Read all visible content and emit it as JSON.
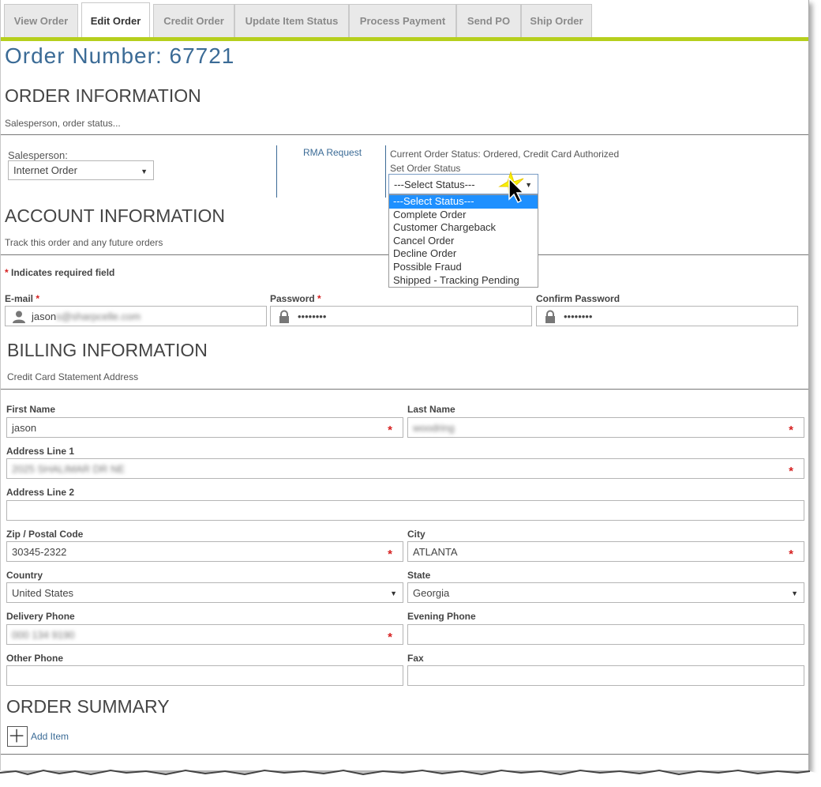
{
  "tabs": [
    {
      "label": "View Order",
      "active": false
    },
    {
      "label": "Edit Order",
      "active": true
    },
    {
      "label": "Credit Order",
      "active": false
    },
    {
      "label": "Update Item Status",
      "active": false
    },
    {
      "label": "Process Payment",
      "active": false
    },
    {
      "label": "Send PO",
      "active": false
    },
    {
      "label": "Ship Order",
      "active": false
    }
  ],
  "colors": {
    "accent": "#b6cf1d",
    "title": "#3b6b96",
    "required": "#d62020",
    "highlight": "#1e90ff"
  },
  "page_title": "Order Number: 67721",
  "order_info": {
    "title": "ORDER INFORMATION",
    "subtitle": "Salesperson, order status...",
    "salesperson_label": "Salesperson:",
    "salesperson_value": "Internet Order",
    "rma_link": "RMA Request",
    "current_status": "Current Order Status: Ordered, Credit Card Authorized",
    "set_status_label": "Set Order Status",
    "status_select_value": "---Select Status---",
    "status_options": [
      "---Select Status---",
      "Complete Order",
      "Customer Chargeback",
      "Cancel Order",
      "Decline Order",
      "Possible Fraud",
      "Shipped - Tracking Pending"
    ]
  },
  "account_info": {
    "title": "ACCOUNT INFORMATION",
    "subtitle": "Track this order and any future orders",
    "required_note": "Indicates required field",
    "email_label": "E-mail",
    "email_value": "jason",
    "email_redacted": "s@sharpcelle.com",
    "password_label": "Password",
    "password_value": "••••••••",
    "confirm_label": "Confirm Password",
    "confirm_value": "••••••••"
  },
  "billing": {
    "title": "BILLING INFORMATION",
    "subtitle": "Credit Card Statement Address",
    "first_name_label": "First Name",
    "first_name_value": "jason",
    "last_name_label": "Last Name",
    "last_name_value": "woodring",
    "address1_label": "Address Line 1",
    "address1_value": "2025 SHALIMAR DR NE",
    "address2_label": "Address Line 2",
    "address2_value": "",
    "zip_label": "Zip / Postal Code",
    "zip_value": "30345-2322",
    "city_label": "City",
    "city_value": "ATLANTA",
    "country_label": "Country",
    "country_value": "United States",
    "state_label": "State",
    "state_value": "Georgia",
    "delivery_phone_label": "Delivery Phone",
    "delivery_phone_value": "000 134 9190",
    "evening_phone_label": "Evening Phone",
    "evening_phone_value": "",
    "other_phone_label": "Other Phone",
    "other_phone_value": "",
    "fax_label": "Fax",
    "fax_value": ""
  },
  "order_summary": {
    "title": "ORDER SUMMARY",
    "add_item": "Add Item"
  }
}
